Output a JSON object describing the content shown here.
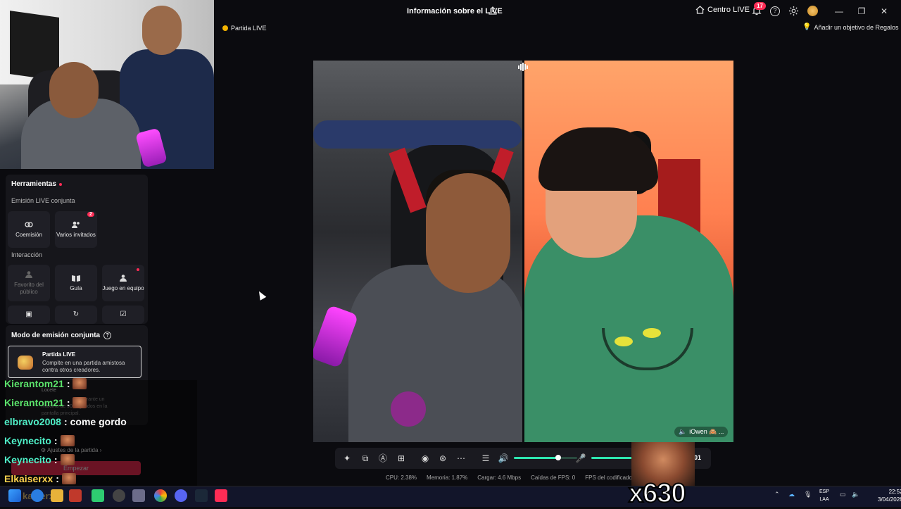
{
  "header": {
    "title": "Información sobre el LIVE",
    "centro_live": "Centro LIVE",
    "notifications_count": "17",
    "help": "?"
  },
  "chips": {
    "partida_live": "Partida LIVE",
    "gift_goal": "Añadir un objetivo de Regalos"
  },
  "video": {
    "guest_name": "iOwen 🙈 ..."
  },
  "tools": {
    "title": "Herramientas",
    "section_cohost": "Emisión LIVE conjunta",
    "coemision": "Coemisión",
    "varios_invitados": "Varios invitados",
    "varios_badge": "2",
    "section_interaction": "Interacción",
    "favorito": "Favorito del público",
    "guia": "Guía",
    "juego_equipo": "Juego en equipo"
  },
  "modo": {
    "title": "Modo de emisión conjunta",
    "partida_title": "Partida LIVE",
    "partida_desc": "Compite en una partida amistosa contra otros creadores.",
    "locete": "Locete",
    "locete_desc_a": "urante un",
    "locete_desc_b": "máximo de 90 segundos en la",
    "locete_desc_c": "pantalla principal.",
    "ajustes": "Ajustes de la partida",
    "empezar": "Empezar"
  },
  "chat": [
    {
      "user": "Kierantom21",
      "sep": ":",
      "msg": "",
      "emote": true,
      "color": "green"
    },
    {
      "user": "Kierantom21",
      "sep": ":",
      "msg": "",
      "emote": true,
      "color": "green"
    },
    {
      "user": "elbravo2008",
      "sep": ":",
      "msg": "come gordo",
      "emote": false,
      "color": "cyan"
    },
    {
      "user": "Keynecito",
      "sep": ":",
      "msg": "",
      "emote": true,
      "color": "cyan"
    },
    {
      "user": "Keynecito",
      "sep": ":",
      "msg": "",
      "emote": true,
      "color": "cyan"
    },
    {
      "user": "Elkaiserxx",
      "sep": ":",
      "msg": "",
      "emote": true,
      "color": "yellow"
    }
  ],
  "combo": "x630",
  "controls": {
    "end_label": "01",
    "volume_level": 0.7
  },
  "stats": {
    "cpu": "CPU: 2.38%",
    "memoria": "Memoria: 1.87%",
    "cargar": "Cargar: 4.6 Mbps",
    "caidas": "Caídas de FPS: 0",
    "fps_codificador": "FPS del codificador: 6"
  },
  "taskbar": {
    "lang_a": "ESP",
    "lang_b": "LAA",
    "time": "22:52",
    "date": "3/04/2026",
    "chat_faded": "kaiserxx"
  },
  "colors": {
    "accent": "#fe2c55",
    "volume": "#2ee6b0"
  }
}
